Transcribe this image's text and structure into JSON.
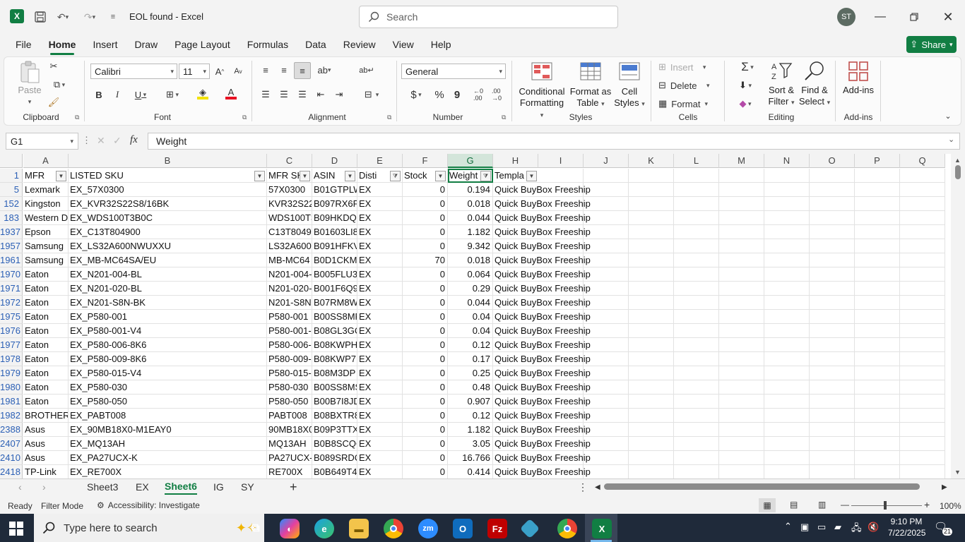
{
  "window": {
    "title": "EOL found  -  Excel",
    "user_initials": "ST"
  },
  "search": {
    "placeholder": "Search"
  },
  "menu": {
    "tabs": [
      "File",
      "Home",
      "Insert",
      "Draw",
      "Page Layout",
      "Formulas",
      "Data",
      "Review",
      "View",
      "Help"
    ],
    "active": "Home",
    "share": "Share"
  },
  "ribbon": {
    "clipboard": {
      "paste": "Paste",
      "label": "Clipboard"
    },
    "font": {
      "name": "Calibri",
      "size": "11",
      "label": "Font"
    },
    "alignment": {
      "label": "Alignment"
    },
    "number": {
      "format": "General",
      "label": "Number"
    },
    "styles": {
      "conditional_1": "Conditional",
      "conditional_2": "Formatting",
      "format_table_1": "Format as",
      "format_table_2": "Table",
      "cell_styles_1": "Cell",
      "cell_styles_2": "Styles",
      "label": "Styles"
    },
    "cells": {
      "insert": "Insert",
      "delete": "Delete",
      "format": "Format",
      "label": "Cells"
    },
    "editing": {
      "sort_1": "Sort &",
      "sort_2": "Filter",
      "find_1": "Find &",
      "find_2": "Select",
      "label": "Editing"
    },
    "addins": {
      "addins": "Add-ins",
      "label": "Add-ins"
    }
  },
  "formula_bar": {
    "name_box": "G1",
    "fx": "fx",
    "value": "Weight"
  },
  "grid": {
    "columns": [
      "A",
      "B",
      "C",
      "D",
      "E",
      "F",
      "G",
      "H",
      "I",
      "J",
      "K",
      "L",
      "M",
      "N",
      "O",
      "P",
      "Q"
    ],
    "selected_column": "G",
    "header_row": {
      "row": "1",
      "cells": [
        "MFR",
        "LISTED SKU",
        "MFR SK",
        "ASIN",
        "Disti",
        "Stock",
        "Weight",
        "Templa"
      ]
    },
    "rows": [
      {
        "row": "5",
        "cells": [
          "Lexmark",
          "EX_57X0300",
          "57X0300",
          "B01GTPLW",
          "EX",
          "0",
          "0.194",
          "Quick BuyBox Freeship"
        ]
      },
      {
        "row": "152",
        "cells": [
          "Kingston",
          "EX_KVR32S22S8/16BK",
          "KVR32S22",
          "B097RX6F",
          "EX",
          "0",
          "0.018",
          "Quick BuyBox Freeship"
        ]
      },
      {
        "row": "183",
        "cells": [
          "Western D",
          "EX_WDS100T3B0C",
          "WDS100T3",
          "B09HKDQ",
          "EX",
          "0",
          "0.044",
          "Quick BuyBox Freeship"
        ]
      },
      {
        "row": "1937",
        "cells": [
          "Epson",
          "EX_C13T804900",
          "C13T8049",
          "B01603LI8",
          "EX",
          "0",
          "1.182",
          "Quick BuyBox Freeship"
        ]
      },
      {
        "row": "1957",
        "cells": [
          "Samsung",
          "EX_LS32A600NWUXXU",
          "LS32A600",
          "B091HFKV",
          "EX",
          "0",
          "9.342",
          "Quick BuyBox Freeship"
        ]
      },
      {
        "row": "1961",
        "cells": [
          "Samsung",
          "EX_MB-MC64SA/EU",
          "MB-MC64",
          "B0D1CKM",
          "EX",
          "70",
          "0.018",
          "Quick BuyBox Freeship"
        ]
      },
      {
        "row": "1970",
        "cells": [
          "Eaton",
          "EX_N201-004-BL",
          "N201-004-",
          "B005FLU3",
          "EX",
          "0",
          "0.064",
          "Quick BuyBox Freeship"
        ]
      },
      {
        "row": "1971",
        "cells": [
          "Eaton",
          "EX_N201-020-BL",
          "N201-020-",
          "B001F6Q9",
          "EX",
          "0",
          "0.29",
          "Quick BuyBox Freeship"
        ]
      },
      {
        "row": "1972",
        "cells": [
          "Eaton",
          "EX_N201-S8N-BK",
          "N201-S8N",
          "B07RM8W",
          "EX",
          "0",
          "0.044",
          "Quick BuyBox Freeship"
        ]
      },
      {
        "row": "1975",
        "cells": [
          "Eaton",
          "EX_P580-001",
          "P580-001",
          "B00SS8MF",
          "EX",
          "0",
          "0.04",
          "Quick BuyBox Freeship"
        ]
      },
      {
        "row": "1976",
        "cells": [
          "Eaton",
          "EX_P580-001-V4",
          "P580-001-",
          "B08GL3GC",
          "EX",
          "0",
          "0.04",
          "Quick BuyBox Freeship"
        ]
      },
      {
        "row": "1977",
        "cells": [
          "Eaton",
          "EX_P580-006-8K6",
          "P580-006-",
          "B08KWPH",
          "EX",
          "0",
          "0.12",
          "Quick BuyBox Freeship"
        ]
      },
      {
        "row": "1978",
        "cells": [
          "Eaton",
          "EX_P580-009-8K6",
          "P580-009-",
          "B08KWP7",
          "EX",
          "0",
          "0.17",
          "Quick BuyBox Freeship"
        ]
      },
      {
        "row": "1979",
        "cells": [
          "Eaton",
          "EX_P580-015-V4",
          "P580-015-",
          "B08M3DP",
          "EX",
          "0",
          "0.25",
          "Quick BuyBox Freeship"
        ]
      },
      {
        "row": "1980",
        "cells": [
          "Eaton",
          "EX_P580-030",
          "P580-030",
          "B00SS8MS",
          "EX",
          "0",
          "0.48",
          "Quick BuyBox Freeship"
        ]
      },
      {
        "row": "1981",
        "cells": [
          "Eaton",
          "EX_P580-050",
          "P580-050",
          "B00B7I8JD",
          "EX",
          "0",
          "0.907",
          "Quick BuyBox Freeship"
        ]
      },
      {
        "row": "1982",
        "cells": [
          "BROTHER",
          "EX_PABT008",
          "PABT008",
          "B08BXTR8",
          "EX",
          "0",
          "0.12",
          "Quick BuyBox Freeship"
        ]
      },
      {
        "row": "2388",
        "cells": [
          "Asus",
          "EX_90MB18X0-M1EAY0",
          "90MB18X0",
          "B09P3TTX",
          "EX",
          "0",
          "1.182",
          "Quick BuyBox Freeship"
        ]
      },
      {
        "row": "2407",
        "cells": [
          "Asus",
          "EX_MQ13AH",
          "MQ13AH",
          "B0B8SCQC",
          "EX",
          "0",
          "3.05",
          "Quick BuyBox Freeship"
        ]
      },
      {
        "row": "2410",
        "cells": [
          "Asus",
          "EX_PA27UCX-K",
          "PA27UCX-",
          "B089SRDC",
          "EX",
          "0",
          "16.766",
          "Quick BuyBox Freeship"
        ]
      },
      {
        "row": "2418",
        "cells": [
          "TP-Link",
          "EX_RE700X",
          "RE700X",
          "B0B649T4",
          "EX",
          "0",
          "0.414",
          "Quick BuyBox Freeship"
        ]
      }
    ]
  },
  "sheet_tabs": {
    "tabs": [
      "Sheet3",
      "EX",
      "Sheet6",
      "IG",
      "SY"
    ],
    "active": "Sheet6"
  },
  "status": {
    "ready": "Ready",
    "mode": "Filter Mode",
    "accessibility": "Accessibility: Investigate",
    "zoom": "100%"
  },
  "taskbar": {
    "search_placeholder": "Type here to search",
    "time": "9:10 PM",
    "date": "7/22/2025",
    "notifications": "21"
  },
  "colors": {
    "accent": "#117e43",
    "selected_header": "#d3e5da",
    "row_number": "#2b5fb5"
  }
}
